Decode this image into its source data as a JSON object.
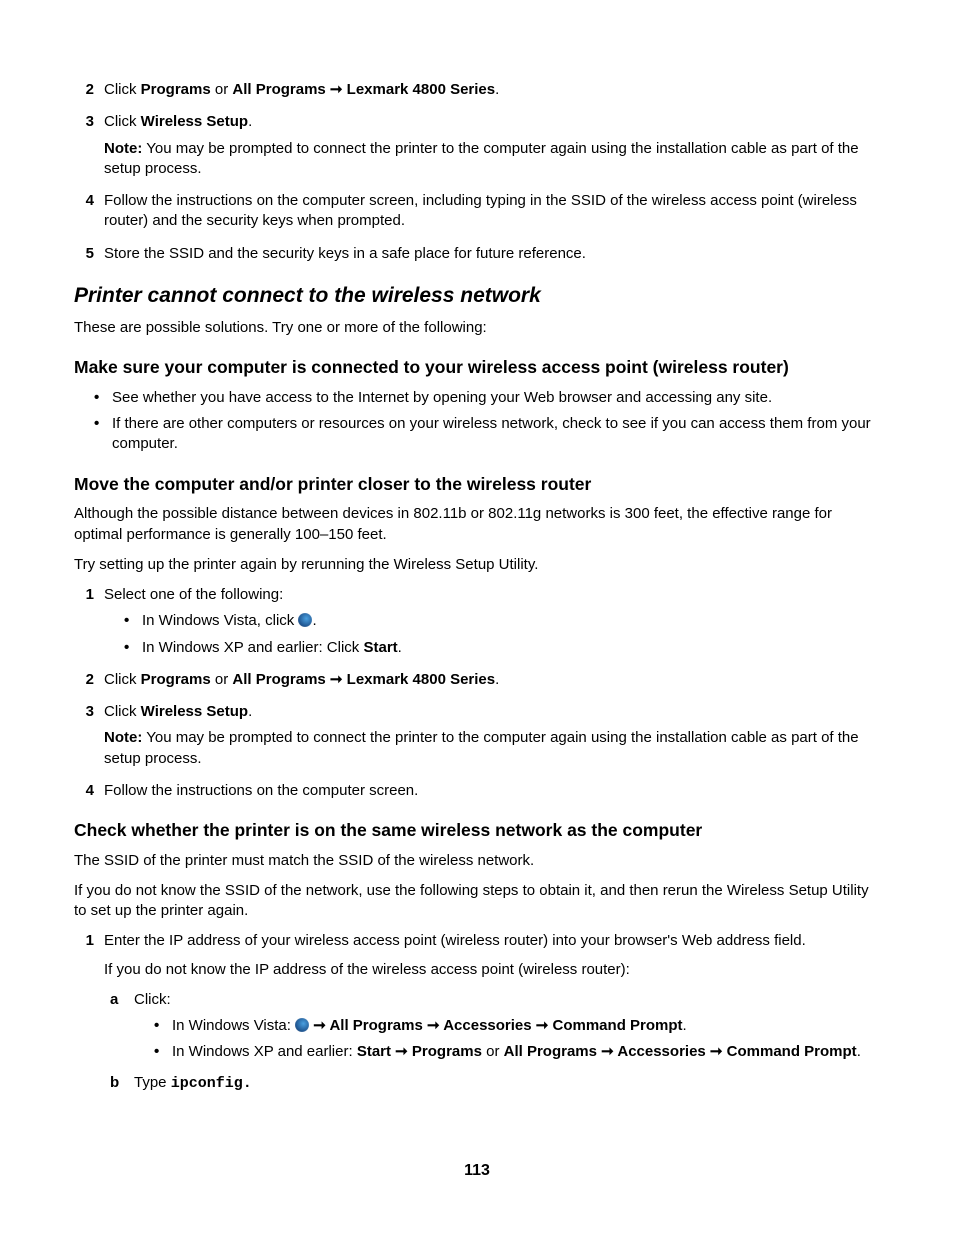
{
  "footer": {
    "page_number": "113"
  },
  "top_steps": {
    "s2": {
      "marker": "2",
      "prefix": "Click ",
      "programs": "Programs",
      "or": " or ",
      "all_programs": "All Programs",
      "arrow": " ➞ ",
      "series": "Lexmark 4800 Series",
      "period": "."
    },
    "s3": {
      "marker": "3",
      "prefix": "Click ",
      "wireless_setup": "Wireless Setup",
      "period": ".",
      "note_label": "Note:",
      "note_text": " You may be prompted to connect the printer to the computer again using the installation cable as part of the setup process."
    },
    "s4": {
      "marker": "4",
      "text": "Follow the instructions on the computer screen, including typing in the SSID of the wireless access point (wireless router) and the security keys when prompted."
    },
    "s5": {
      "marker": "5",
      "text": "Store the SSID and the security keys in a safe place for future reference."
    }
  },
  "section_printer_cannot": {
    "heading": "Printer cannot connect to the wireless network",
    "intro": "These are possible solutions. Try one or more of the following:"
  },
  "section_make_sure": {
    "heading": "Make sure your computer is connected to your wireless access point (wireless router)",
    "b1": "See whether you have access to the Internet by opening your Web browser and accessing any site.",
    "b2": "If there are other computers or resources on your wireless network, check to see if you can access them from your computer."
  },
  "section_move": {
    "heading": "Move the computer and/or printer closer to the wireless router",
    "p1": "Although the possible distance between devices in 802.11b or 802.11g networks is 300 feet, the effective range for optimal performance is generally 100–150 feet.",
    "p2": "Try setting up the printer again by rerunning the Wireless Setup Utility.",
    "s1": {
      "marker": "1",
      "text": "Select one of the following:",
      "vista_prefix": "In Windows Vista, click ",
      "vista_period": ".",
      "xp_prefix": "In Windows XP and earlier: Click ",
      "xp_start": "Start",
      "xp_period": "."
    },
    "s2": {
      "marker": "2",
      "prefix": "Click ",
      "programs": "Programs",
      "or": " or ",
      "all_programs": "All Programs",
      "arrow": " ➞ ",
      "series": "Lexmark 4800 Series",
      "period": "."
    },
    "s3": {
      "marker": "3",
      "prefix": "Click ",
      "wireless_setup": "Wireless Setup",
      "period": ".",
      "note_label": "Note:",
      "note_text": " You may be prompted to connect the printer to the computer again using the installation cable as part of the setup process."
    },
    "s4": {
      "marker": "4",
      "text": "Follow the instructions on the computer screen."
    }
  },
  "section_check": {
    "heading": "Check whether the printer is on the same wireless network as the computer",
    "p1": "The SSID of the printer must match the SSID of the wireless network.",
    "p2": "If you do not know the SSID of the network, use the following steps to obtain it, and then rerun the Wireless Setup Utility to set up the printer again.",
    "s1": {
      "marker": "1",
      "text": "Enter the IP address of your wireless access point (wireless router) into your browser's Web address field.",
      "p_after": "If you do not know the IP address of the wireless access point (wireless router):",
      "a": {
        "marker": "a",
        "text": "Click:",
        "vista_prefix": "In Windows Vista: ",
        "arrow": " ➞ ",
        "all_programs": "All Programs",
        "accessories": "Accessories",
        "cmd": "Command Prompt",
        "period": ".",
        "xp_prefix": "In Windows XP and earlier: ",
        "xp_start": "Start",
        "xp_programs": "Programs",
        "xp_or": " or ",
        "xp_all_programs": "All Programs",
        "xp_accessories": "Accessories",
        "xp_cmd": "Command Prompt",
        "xp_period": "."
      },
      "b": {
        "marker": "b",
        "prefix": "Type ",
        "cmd": "ipconfig",
        "period": "."
      }
    }
  }
}
